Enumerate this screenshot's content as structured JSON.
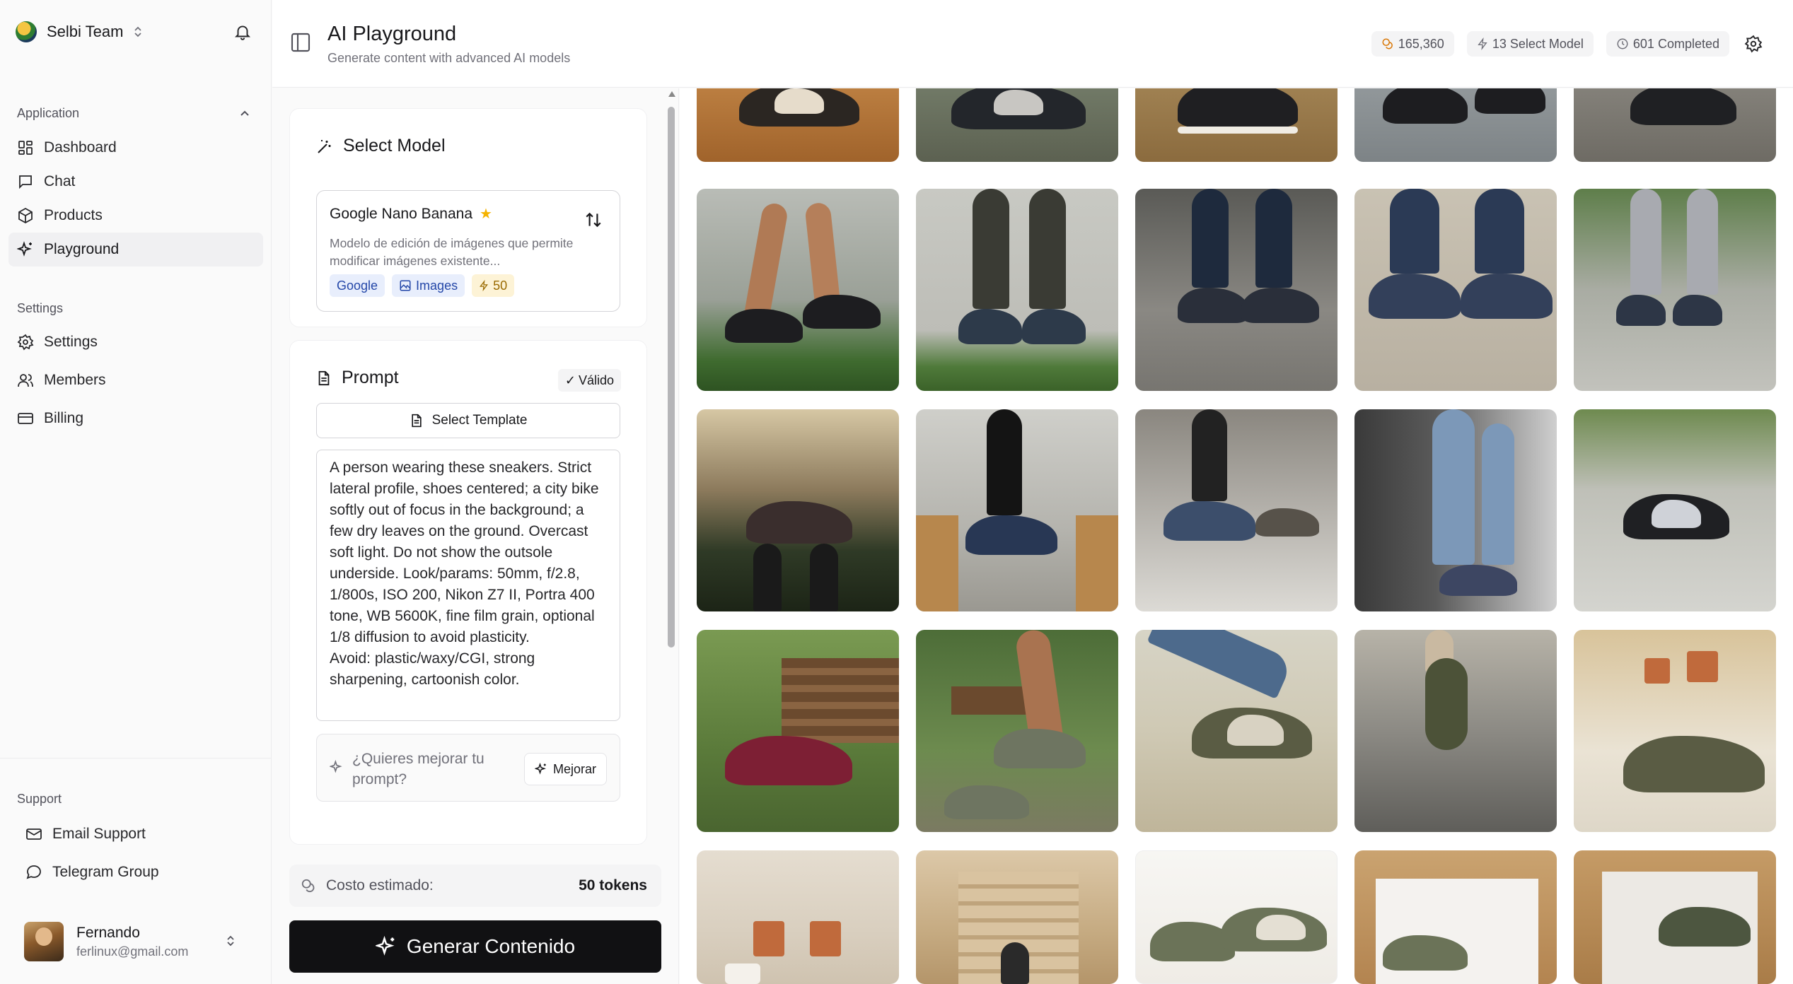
{
  "sidebar": {
    "team_name": "Selbi Team",
    "application_label": "Application",
    "nav": [
      {
        "label": "Dashboard",
        "icon": "grid-icon"
      },
      {
        "label": "Chat",
        "icon": "chat-icon"
      },
      {
        "label": "Products",
        "icon": "package-icon"
      },
      {
        "label": "Playground",
        "icon": "sparkles-icon",
        "active": true
      }
    ],
    "settings_label": "Settings",
    "settings_nav": [
      {
        "label": "Settings",
        "icon": "gear-icon"
      },
      {
        "label": "Members",
        "icon": "users-icon"
      },
      {
        "label": "Billing",
        "icon": "card-icon"
      }
    ],
    "support_label": "Support",
    "support": [
      {
        "label": "Email Support",
        "icon": "mail-icon"
      },
      {
        "label": "Telegram Group",
        "icon": "chat-icon"
      }
    ],
    "user": {
      "name": "Fernando",
      "email": "ferlinux@gmail.com"
    }
  },
  "header": {
    "title": "AI Playground",
    "subtitle": "Generate content with advanced AI models",
    "stats": {
      "tokens": "165,360",
      "models": "13 Select Model",
      "completed": "601 Completed"
    }
  },
  "model_card": {
    "title": "Select Model",
    "model_name": "Google Nano Banana",
    "description": "Modelo de edición de imágenes que permite modificar imágenes existente...",
    "badges": {
      "provider": "Google",
      "type": "Images",
      "cost": "50"
    }
  },
  "prompt_card": {
    "title": "Prompt",
    "status": "Válido",
    "template_button": "Select Template",
    "prompt_text": "A person wearing these sneakers. Strict lateral profile, shoes centered; a city bike softly out of focus in the background; a few dry leaves on the ground. Overcast soft light. Do not show the outsole underside. Look/params: 50mm, f/2.8, 1/800s, ISO 200, Nikon Z7 II, Portra 400 tone, WB 5600K, fine film grain, optional 1/8 diffusion to avoid plasticity.\nAvoid: plastic/waxy/CGI, strong sharpening, cartoonish color.",
    "improve_prompt": "¿Quieres mejorar tu prompt?",
    "improve_button": "Mejorar"
  },
  "footer": {
    "cost_label": "Costo estimado:",
    "cost_value": "50 tokens",
    "generate_button": "Generar Contenido"
  },
  "colors": {
    "accent": "#111113",
    "badge_blue": "#2447a8",
    "badge_amber": "#9a6a00",
    "star": "#f5b301"
  }
}
